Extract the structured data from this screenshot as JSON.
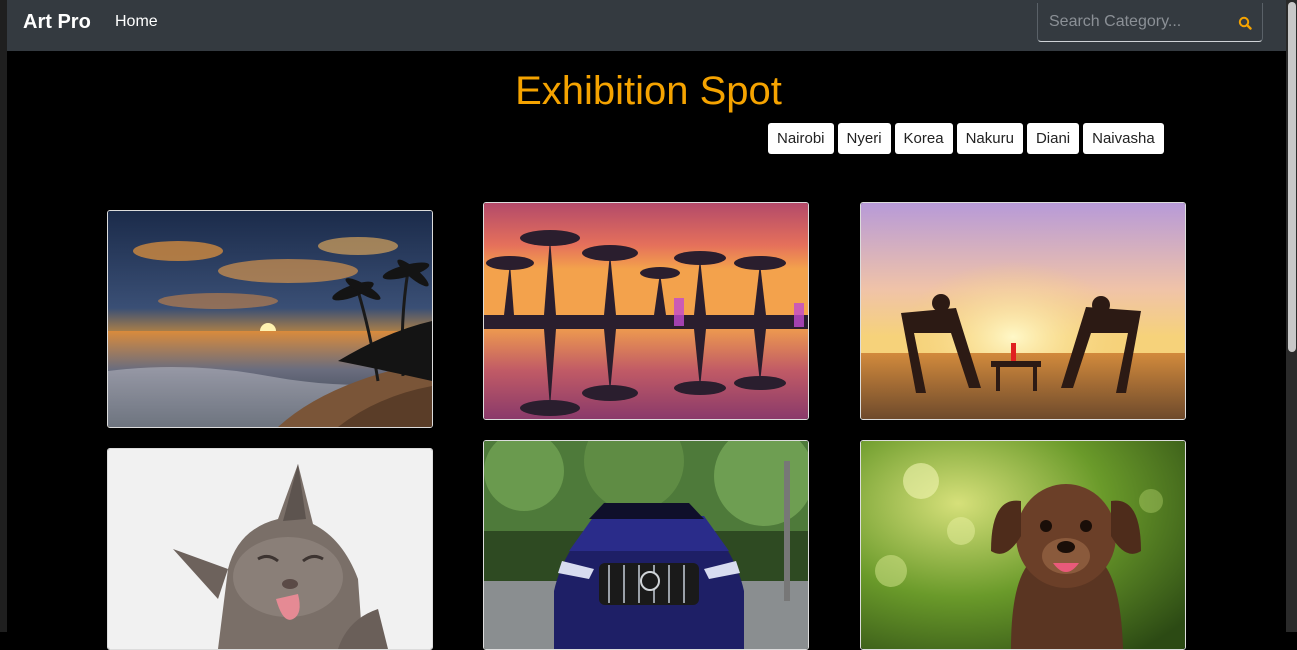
{
  "navbar": {
    "brand": "Art Pro",
    "home_link": "Home",
    "search_placeholder": "Search Category..."
  },
  "page": {
    "title": "Exhibition Spot"
  },
  "categories": [
    "Nairobi",
    "Nyeri",
    "Korea",
    "Nakuru",
    "Diani",
    "Naivasha"
  ],
  "gallery": [
    {
      "icon": "beach-sunset-photo"
    },
    {
      "icon": "palm-reflection-photo"
    },
    {
      "icon": "beach-chairs-photo"
    },
    {
      "icon": "cat-photo"
    },
    {
      "icon": "car-photo"
    },
    {
      "icon": "puppy-photo"
    }
  ],
  "colors": {
    "accent": "#f5a300",
    "navbar": "#343a40"
  }
}
